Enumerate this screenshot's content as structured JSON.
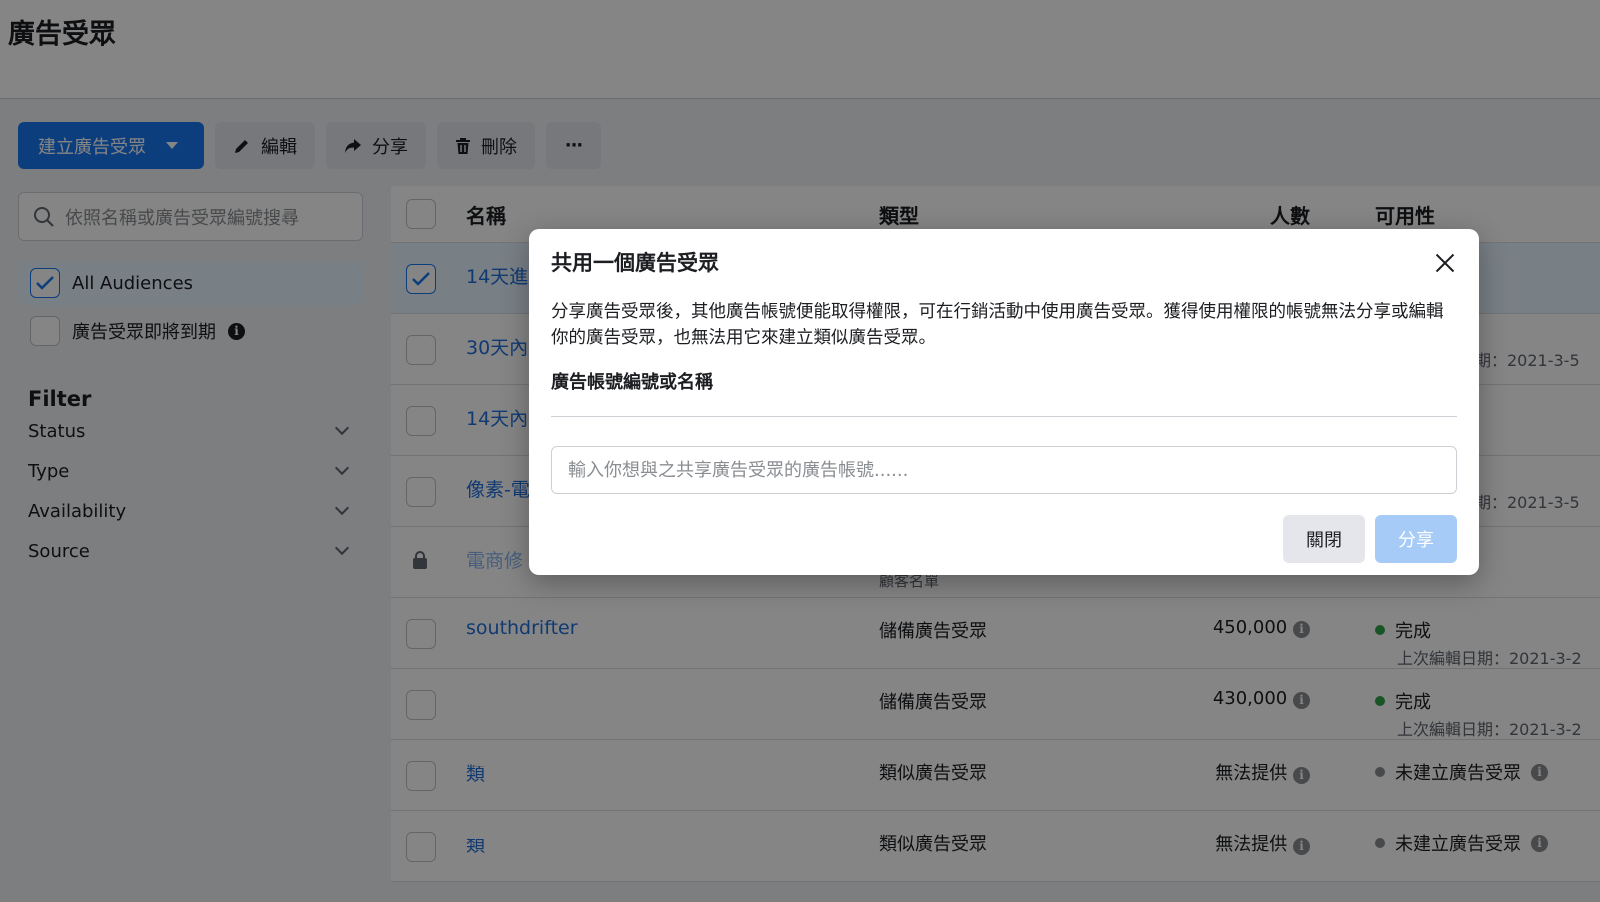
{
  "page": {
    "title": "廣告受眾"
  },
  "toolbar": {
    "create_label": "建立廣告受眾",
    "edit_label": "編輯",
    "share_label": "分享",
    "delete_label": "刪除",
    "more_label": "···"
  },
  "sidebar": {
    "search_placeholder": "依照名稱或廣告受眾編號搜尋",
    "all_audiences": "All Audiences",
    "expiring": "廣告受眾即將到期",
    "filter_title": "Filter",
    "filters": [
      "Status",
      "Type",
      "Availability",
      "Source"
    ]
  },
  "table": {
    "headers": {
      "name": "名稱",
      "type": "類型",
      "count": "人數",
      "availability": "可用性"
    },
    "rows": [
      {
        "name": "14天進",
        "type": "",
        "type_sub": "",
        "count": "",
        "status": "",
        "status_sub": "",
        "checked": true
      },
      {
        "name": "30天內",
        "type": "",
        "type_sub": "",
        "count": "",
        "status": "",
        "status_sub": "期：2021-3-5"
      },
      {
        "name": "14天內",
        "type": "",
        "type_sub": "",
        "count": "",
        "status": "",
        "status_sub": ""
      },
      {
        "name": "像素-電",
        "type": "",
        "type_sub": "",
        "count": "",
        "status": "",
        "status_sub": "期：2021-3-5"
      },
      {
        "name": "電商修",
        "type": "",
        "type_sub": "顧客名單",
        "count": "",
        "status": "",
        "status_sub": "",
        "locked": true
      },
      {
        "name": "southdrifter",
        "type": "儲備廣告受眾",
        "type_sub": "",
        "count": "450,000",
        "status": "完成",
        "status_sub": "上次編輯日期：2021-3-2"
      },
      {
        "name": "",
        "type": "儲備廣告受眾",
        "type_sub": "",
        "count": "430,000",
        "status": "完成",
        "status_sub": "上次編輯日期：2021-3-2"
      },
      {
        "name": "類",
        "type": "類似廣告受眾",
        "type_sub": "",
        "count": "無法提供",
        "status": "未建立廣告受眾",
        "status_sub": ""
      },
      {
        "name": "類",
        "type": "類似廣告受眾",
        "type_sub": "",
        "count": "無法提供",
        "status": "未建立廣告受眾",
        "status_sub": ""
      }
    ]
  },
  "modal": {
    "title": "共用一個廣告受眾",
    "description": "分享廣告受眾後，其他廣告帳號便能取得權限，可在行銷活動中使用廣告受眾。獲得使用權限的帳號無法分享或編輯你的廣告受眾，也無法用它來建立類似廣告受眾。",
    "field_label": "廣告帳號編號或名稱",
    "input_placeholder": "輸入你想與之共享廣告受眾的廣告帳號......",
    "input_value": "",
    "close_label": "關閉",
    "share_label": "分享"
  },
  "colors": {
    "accent": "#1877f2",
    "status_done": "#31a24c",
    "status_na": "#8a8d91",
    "link": "#216fdb"
  }
}
